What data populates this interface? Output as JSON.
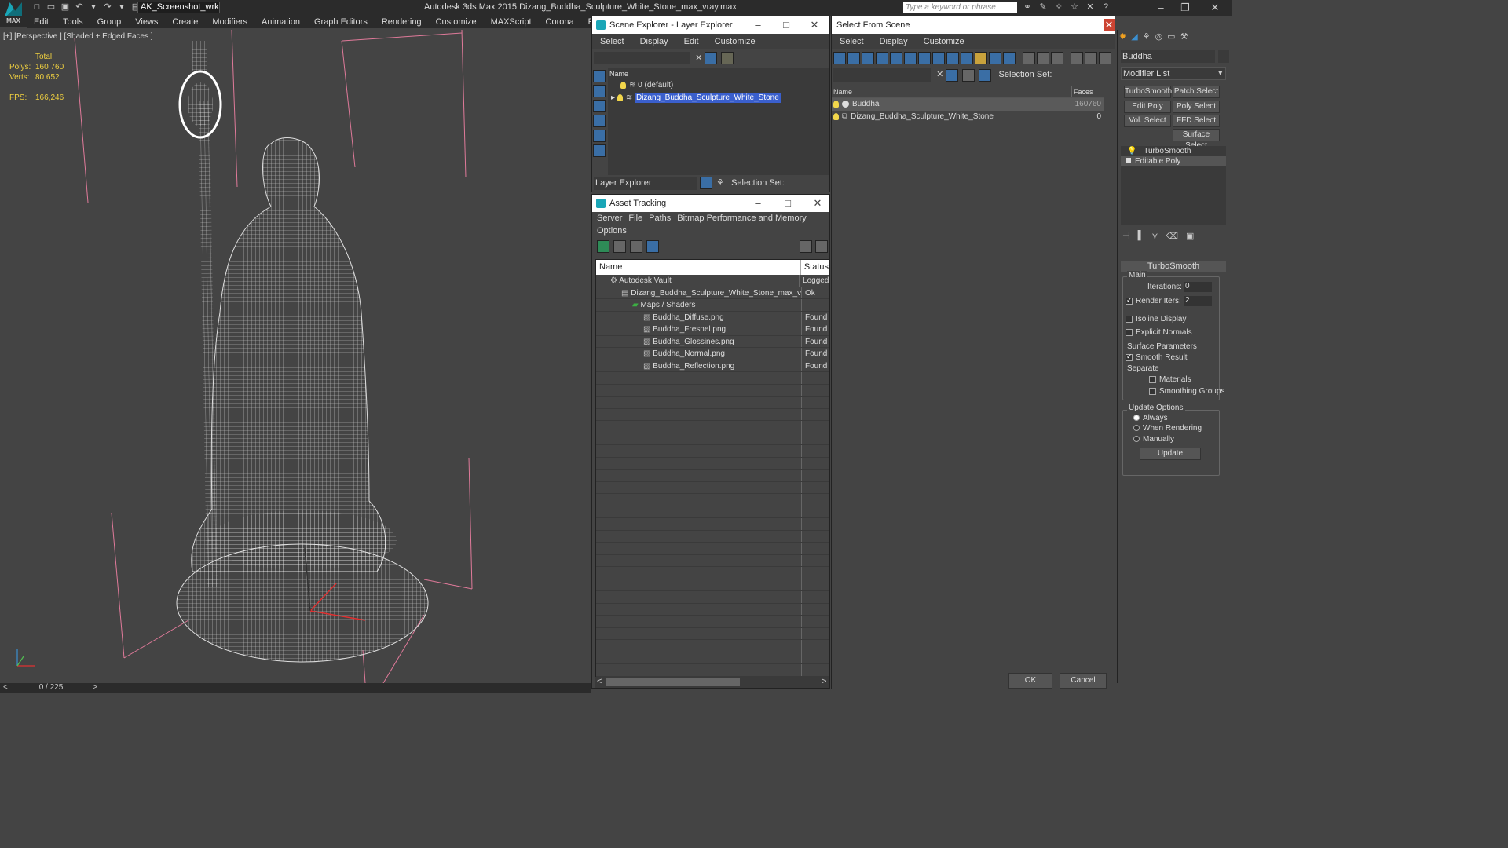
{
  "app": {
    "logo_text": "MAX",
    "workspace": "AK_Screenshot_wrksp",
    "title": "Autodesk 3ds Max  2015     Dizang_Buddha_Sculpture_White_Stone_max_vray.max",
    "search_placeholder": "Type a keyword or phrase"
  },
  "menu": [
    "Edit",
    "Tools",
    "Group",
    "Views",
    "Create",
    "Modifiers",
    "Animation",
    "Graph Editors",
    "Rendering",
    "Customize",
    "MAXScript",
    "Corona",
    "Project Man"
  ],
  "viewport": {
    "label": "[+] [Perspective ] [Shaded + Edged Faces ]",
    "stats": {
      "total_label": "Total",
      "polys_label": "Polys:",
      "polys": "160 760",
      "verts_label": "Verts:",
      "verts": "80 652",
      "fps_label": "FPS:",
      "fps": "166,246"
    },
    "time": "0 / 225"
  },
  "scene_explorer": {
    "title": "Scene Explorer - Layer Explorer",
    "menu": [
      "Select",
      "Display",
      "Edit",
      "Customize"
    ],
    "column": "Name",
    "rows": [
      "0 (default)",
      "Dizang_Buddha_Sculpture_White_Stone"
    ],
    "footer_mode": "Layer Explorer",
    "selection_set": "Selection Set:"
  },
  "asset_tracking": {
    "title": "Asset Tracking",
    "menu": [
      "Server",
      "File",
      "Paths",
      "Bitmap Performance and Memory"
    ],
    "menu2": "Options",
    "col_name": "Name",
    "col_status": "Status",
    "rows": [
      {
        "name": "Autodesk Vault",
        "status": "Logged"
      },
      {
        "name": "Dizang_Buddha_Sculpture_White_Stone_max_vr...",
        "status": "Ok"
      },
      {
        "name": "Maps / Shaders",
        "status": ""
      },
      {
        "name": "Buddha_Diffuse.png",
        "status": "Found"
      },
      {
        "name": "Buddha_Fresnel.png",
        "status": "Found"
      },
      {
        "name": "Buddha_Glossines.png",
        "status": "Found"
      },
      {
        "name": "Buddha_Normal.png",
        "status": "Found"
      },
      {
        "name": "Buddha_Reflection.png",
        "status": "Found"
      }
    ]
  },
  "select_from_scene": {
    "title": "Select From Scene",
    "menu": [
      "Select",
      "Display",
      "Customize"
    ],
    "selection_set": "Selection Set:",
    "col_name": "Name",
    "col_faces": "Faces",
    "rows": [
      {
        "name": "Buddha",
        "faces": "160760"
      },
      {
        "name": "Dizang_Buddha_Sculpture_White_Stone",
        "faces": "0"
      }
    ],
    "ok": "OK",
    "cancel": "Cancel"
  },
  "command_panel": {
    "object_name": "Buddha",
    "modifier_list": "Modifier List",
    "buttons": [
      "TurboSmooth",
      "Patch Select",
      "Edit Poly",
      "Poly Select",
      "Vol. Select",
      "FFD Select",
      "Surface Select"
    ],
    "stack": [
      "TurboSmooth",
      "Editable Poly"
    ],
    "rollout_title": "TurboSmooth",
    "main_label": "Main",
    "iterations_label": "Iterations:",
    "iterations": "0",
    "render_iters_label": "Render Iters:",
    "render_iters": "2",
    "isoline": "Isoline Display",
    "explicit": "Explicit Normals",
    "surface_params": "Surface Parameters",
    "smooth_result": "Smooth Result",
    "separate": "Separate",
    "materials": "Materials",
    "smoothing_groups": "Smoothing Groups",
    "update_options": "Update Options",
    "always": "Always",
    "when_rendering": "When Rendering",
    "manually": "Manually",
    "update": "Update"
  }
}
